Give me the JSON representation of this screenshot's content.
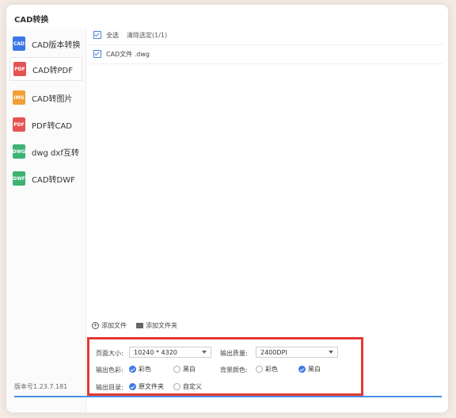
{
  "window": {
    "title": "CAD转换"
  },
  "sidebar": {
    "items": [
      {
        "label": "CAD版本转换",
        "icon": "document-icon",
        "color": "#3b78e7",
        "text": "CAD"
      },
      {
        "label": "CAD转PDF",
        "icon": "pdf-icon",
        "color": "#e55353",
        "text": "PDF"
      },
      {
        "label": "CAD转图片",
        "icon": "image-icon",
        "color": "#f0a036",
        "text": "IMG"
      },
      {
        "label": "PDF转CAD",
        "icon": "pdf-icon",
        "color": "#e55353",
        "text": "PDF"
      },
      {
        "label": "dwg dxf互转",
        "icon": "dwg-icon",
        "color": "#3cb371",
        "text": "DWG"
      },
      {
        "label": "CAD转DWF",
        "icon": "dwf-icon",
        "color": "#3cb371",
        "text": "DWF"
      }
    ],
    "active_index": 1
  },
  "version": "版本号1.23.7.181",
  "file_list": {
    "select_all": "全选",
    "clear": "清除选定(1/1)",
    "files": [
      {
        "name": "CAD文件 .dwg"
      }
    ]
  },
  "actions": {
    "add_file": "添加文件",
    "add_folder": "添加文件夹"
  },
  "settings": {
    "page_size_label": "页面大小:",
    "page_size_value": "10240 * 4320",
    "quality_label": "输出质量:",
    "quality_value": "2400DPI",
    "color_label": "输出色彩:",
    "color_options": [
      "彩色",
      "黑白"
    ],
    "color_selected": "彩色",
    "bg_label": "背景颜色:",
    "bg_options": [
      "彩色",
      "黑白"
    ],
    "bg_selected": "黑白",
    "output_label": "输出目录:",
    "output_options": [
      "原文件夹",
      "自定义"
    ],
    "output_selected": "原文件夹"
  },
  "colors": {
    "accent": "#3b78e7",
    "highlight_border": "#e53935"
  }
}
